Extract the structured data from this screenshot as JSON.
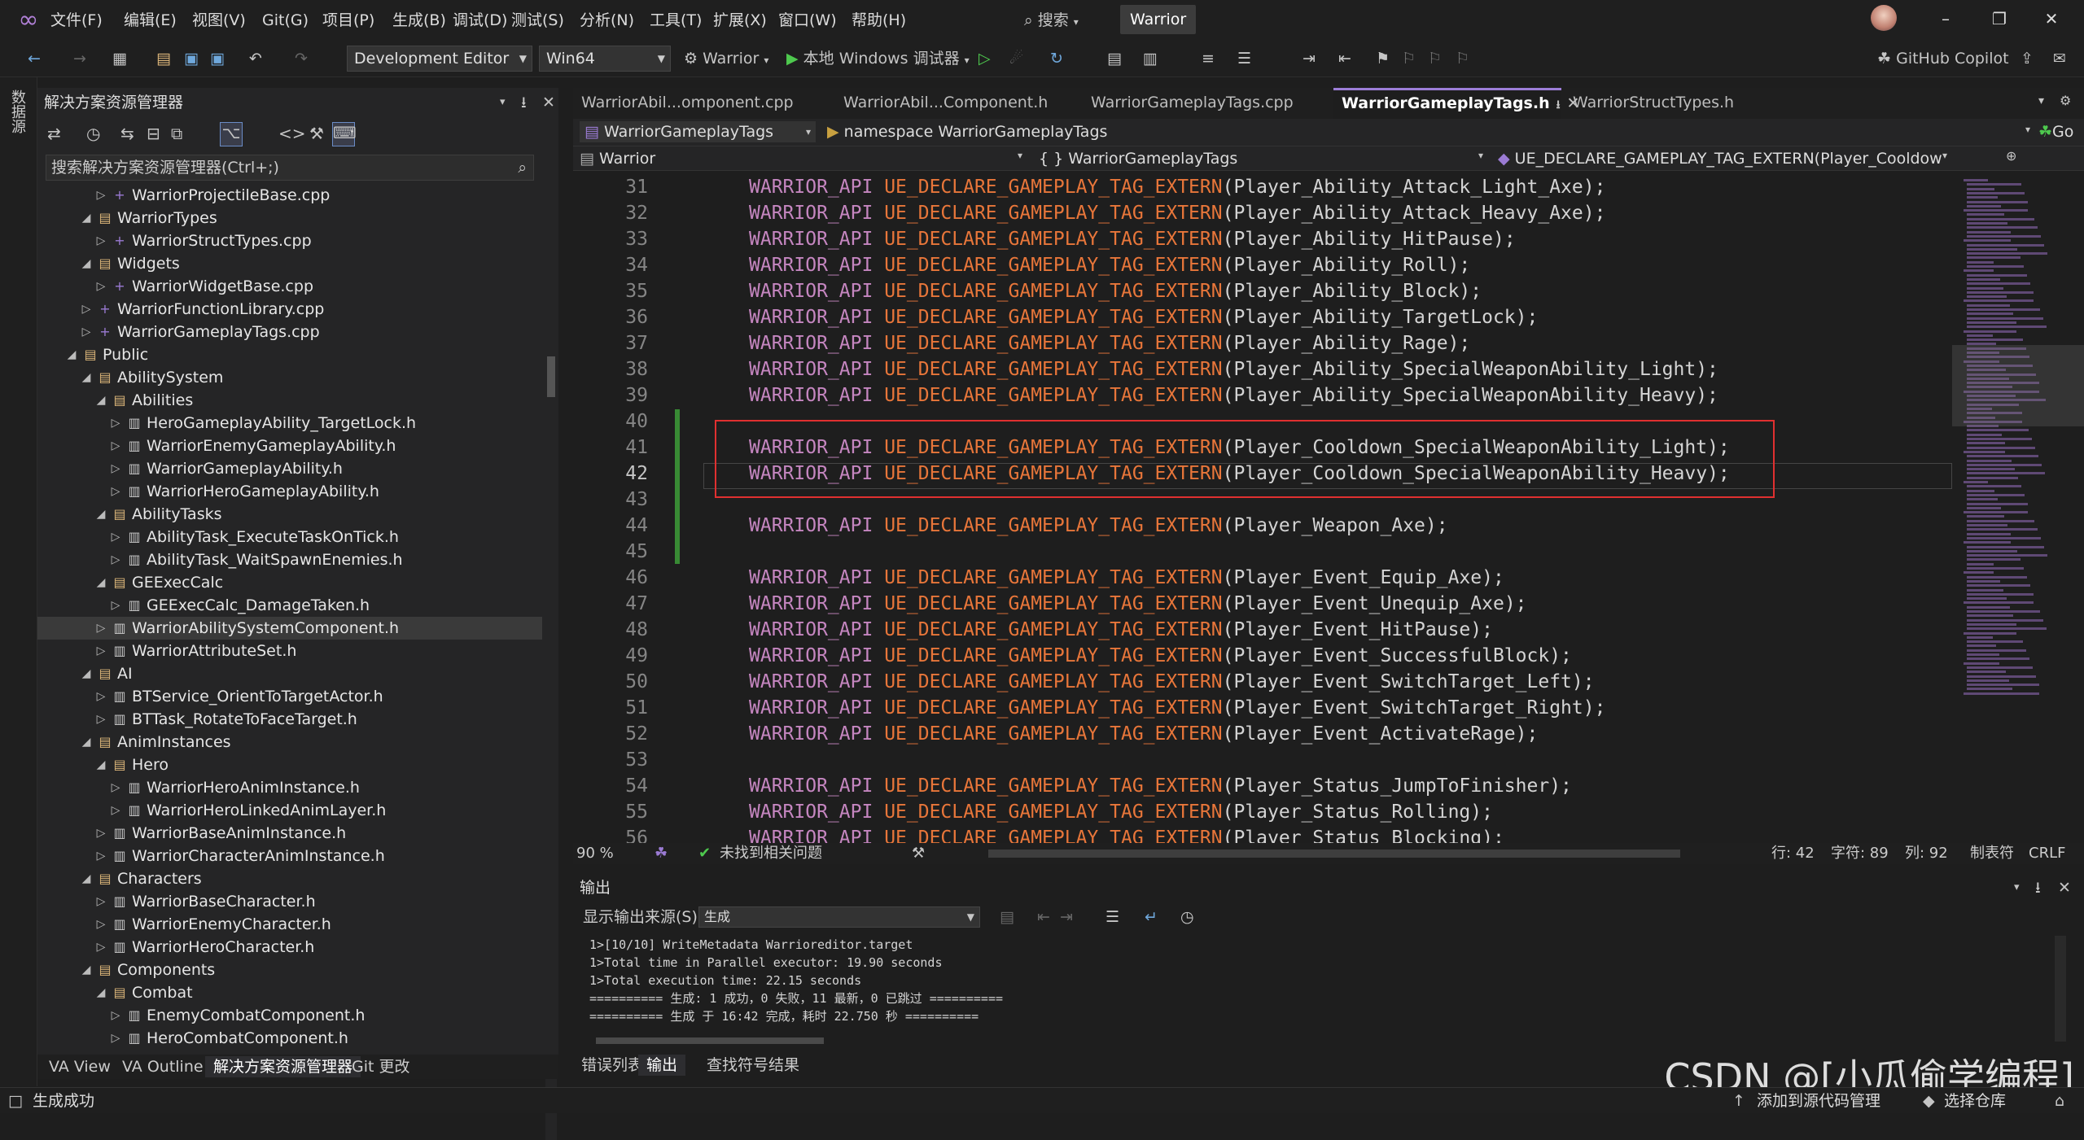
{
  "title_bar": {
    "menus": [
      "文件(F)",
      "编辑(E)",
      "视图(V)",
      "Git(G)",
      "项目(P)",
      "生成(B)",
      "调试(D)",
      "测试(S)",
      "分析(N)",
      "工具(T)",
      "扩展(X)",
      "窗口(W)",
      "帮助(H)"
    ],
    "search_label": "搜索",
    "solution_name": "Warrior"
  },
  "toolbar": {
    "config": "Development Editor",
    "platform": "Win64",
    "startup_project": "Warrior",
    "run_label": "本地 Windows 调试器",
    "copilot": "GitHub Copilot"
  },
  "left_rail": {
    "label": "数据源"
  },
  "solution_explorer": {
    "title": "解决方案资源管理器",
    "search_placeholder": "搜索解决方案资源管理器(Ctrl+;)",
    "items": [
      {
        "label": "WarriorProjectileBase.cpp",
        "kind": "cpp",
        "depth": 3,
        "expand": "closed"
      },
      {
        "label": "WarriorTypes",
        "kind": "folder",
        "depth": 2,
        "expand": "open"
      },
      {
        "label": "WarriorStructTypes.cpp",
        "kind": "cpp",
        "depth": 3,
        "expand": "closed"
      },
      {
        "label": "Widgets",
        "kind": "folder",
        "depth": 2,
        "expand": "open"
      },
      {
        "label": "WarriorWidgetBase.cpp",
        "kind": "cpp",
        "depth": 3,
        "expand": "closed"
      },
      {
        "label": "WarriorFunctionLibrary.cpp",
        "kind": "cpp",
        "depth": 2,
        "expand": "closed"
      },
      {
        "label": "WarriorGameplayTags.cpp",
        "kind": "cpp",
        "depth": 2,
        "expand": "closed"
      },
      {
        "label": "Public",
        "kind": "folder",
        "depth": 1,
        "expand": "open"
      },
      {
        "label": "AbilitySystem",
        "kind": "folder",
        "depth": 2,
        "expand": "open"
      },
      {
        "label": "Abilities",
        "kind": "folder",
        "depth": 3,
        "expand": "open"
      },
      {
        "label": "HeroGameplayAbility_TargetLock.h",
        "kind": "h",
        "depth": 4,
        "expand": "closed"
      },
      {
        "label": "WarriorEnemyGameplayAbility.h",
        "kind": "h",
        "depth": 4,
        "expand": "closed"
      },
      {
        "label": "WarriorGameplayAbility.h",
        "kind": "h",
        "depth": 4,
        "expand": "closed"
      },
      {
        "label": "WarriorHeroGameplayAbility.h",
        "kind": "h",
        "depth": 4,
        "expand": "closed"
      },
      {
        "label": "AbilityTasks",
        "kind": "folder",
        "depth": 3,
        "expand": "open"
      },
      {
        "label": "AbilityTask_ExecuteTaskOnTick.h",
        "kind": "h",
        "depth": 4,
        "expand": "closed"
      },
      {
        "label": "AbilityTask_WaitSpawnEnemies.h",
        "kind": "h",
        "depth": 4,
        "expand": "closed"
      },
      {
        "label": "GEExecCalc",
        "kind": "folder",
        "depth": 3,
        "expand": "open"
      },
      {
        "label": "GEExecCalc_DamageTaken.h",
        "kind": "h",
        "depth": 4,
        "expand": "closed"
      },
      {
        "label": "WarriorAbilitySystemComponent.h",
        "kind": "h",
        "depth": 3,
        "expand": "closed",
        "selected": true
      },
      {
        "label": "WarriorAttributeSet.h",
        "kind": "h",
        "depth": 3,
        "expand": "closed"
      },
      {
        "label": "AI",
        "kind": "folder",
        "depth": 2,
        "expand": "open"
      },
      {
        "label": "BTService_OrientToTargetActor.h",
        "kind": "h",
        "depth": 3,
        "expand": "closed"
      },
      {
        "label": "BTTask_RotateToFaceTarget.h",
        "kind": "h",
        "depth": 3,
        "expand": "closed"
      },
      {
        "label": "AnimInstances",
        "kind": "folder",
        "depth": 2,
        "expand": "open"
      },
      {
        "label": "Hero",
        "kind": "folder",
        "depth": 3,
        "expand": "open"
      },
      {
        "label": "WarriorHeroAnimInstance.h",
        "kind": "h",
        "depth": 4,
        "expand": "closed"
      },
      {
        "label": "WarriorHeroLinkedAnimLayer.h",
        "kind": "h",
        "depth": 4,
        "expand": "closed"
      },
      {
        "label": "WarriorBaseAnimInstance.h",
        "kind": "h",
        "depth": 3,
        "expand": "closed"
      },
      {
        "label": "WarriorCharacterAnimInstance.h",
        "kind": "h",
        "depth": 3,
        "expand": "closed"
      },
      {
        "label": "Characters",
        "kind": "folder",
        "depth": 2,
        "expand": "open"
      },
      {
        "label": "WarriorBaseCharacter.h",
        "kind": "h",
        "depth": 3,
        "expand": "closed"
      },
      {
        "label": "WarriorEnemyCharacter.h",
        "kind": "h",
        "depth": 3,
        "expand": "closed"
      },
      {
        "label": "WarriorHeroCharacter.h",
        "kind": "h",
        "depth": 3,
        "expand": "closed"
      },
      {
        "label": "Components",
        "kind": "folder",
        "depth": 2,
        "expand": "open"
      },
      {
        "label": "Combat",
        "kind": "folder",
        "depth": 3,
        "expand": "open"
      },
      {
        "label": "EnemyCombatComponent.h",
        "kind": "h",
        "depth": 4,
        "expand": "closed"
      },
      {
        "label": "HeroCombatComponent.h",
        "kind": "h",
        "depth": 4,
        "expand": "closed"
      }
    ],
    "bottom_tabs": [
      "VA View",
      "VA Outline",
      "解决方案资源管理器",
      "Git 更改"
    ]
  },
  "editor": {
    "tabs": [
      {
        "label": "WarriorAbil...omponent.cpp",
        "active": false
      },
      {
        "label": "WarriorAbil...Component.h",
        "active": false
      },
      {
        "label": "WarriorGameplayTags.cpp",
        "active": false
      },
      {
        "label": "WarriorGameplayTags.h",
        "active": true
      },
      {
        "label": "WarriorStructTypes.h",
        "active": false
      }
    ],
    "nav_file": "WarriorGameplayTags",
    "nav_namespace": "namespace WarriorGameplayTags",
    "nav_go": "Go",
    "nav_project": "Warrior",
    "nav_scope": "{ } WarriorGameplayTags",
    "nav_member": "UE_DECLARE_GAMEPLAY_TAG_EXTERN(Player_Cooldown_S",
    "lines": [
      {
        "n": "31",
        "arg": "Player_Ability_Attack_Light_Axe"
      },
      {
        "n": "32",
        "arg": "Player_Ability_Attack_Heavy_Axe"
      },
      {
        "n": "33",
        "arg": "Player_Ability_HitPause"
      },
      {
        "n": "34",
        "arg": "Player_Ability_Roll"
      },
      {
        "n": "35",
        "arg": "Player_Ability_Block"
      },
      {
        "n": "36",
        "arg": "Player_Ability_TargetLock"
      },
      {
        "n": "37",
        "arg": "Player_Ability_Rage"
      },
      {
        "n": "38",
        "arg": "Player_Ability_SpecialWeaponAbility_Light"
      },
      {
        "n": "39",
        "arg": "Player_Ability_SpecialWeaponAbility_Heavy"
      },
      {
        "n": "40",
        "arg": ""
      },
      {
        "n": "41",
        "arg": "Player_Cooldown_SpecialWeaponAbility_Light"
      },
      {
        "n": "42",
        "arg": "Player_Cooldown_SpecialWeaponAbility_Heavy"
      },
      {
        "n": "43",
        "arg": ""
      },
      {
        "n": "44",
        "arg": "Player_Weapon_Axe"
      },
      {
        "n": "45",
        "arg": ""
      },
      {
        "n": "46",
        "arg": "Player_Event_Equip_Axe"
      },
      {
        "n": "47",
        "arg": "Player_Event_Unequip_Axe"
      },
      {
        "n": "48",
        "arg": "Player_Event_HitPause"
      },
      {
        "n": "49",
        "arg": "Player_Event_SuccessfulBlock"
      },
      {
        "n": "50",
        "arg": "Player_Event_SwitchTarget_Left"
      },
      {
        "n": "51",
        "arg": "Player_Event_SwitchTarget_Right"
      },
      {
        "n": "52",
        "arg": "Player_Event_ActivateRage"
      },
      {
        "n": "53",
        "arg": ""
      },
      {
        "n": "54",
        "arg": "Player_Status_JumpToFinisher"
      },
      {
        "n": "55",
        "arg": "Player_Status_Rolling"
      },
      {
        "n": "56",
        "arg": "Player_Status_Blocking"
      }
    ],
    "kw_api": "WARRIOR_API",
    "kw_macro": "UE_DECLARE_GAMEPLAY_TAG_EXTERN",
    "current_line": "42",
    "status": {
      "zoom": "90 %",
      "issues": "未找到相关问题",
      "row": "行: 42",
      "char": "字符: 89",
      "col": "列: 92",
      "tabs": "制表符",
      "eol": "CRLF"
    }
  },
  "output": {
    "title": "输出",
    "source_label": "显示输出来源(S):",
    "source_value": "生成",
    "lines": [
      "1>[10/10] WriteMetadata Warrioreditor.target",
      "1>Total time in Parallel executor: 19.90 seconds",
      "1>Total execution time: 22.15 seconds",
      "========== 生成: 1 成功，0 失败，11 最新，0 已跳过 ==========",
      "========== 生成 于 16:42 完成，耗时 22.750 秒 =========="
    ],
    "tabs": [
      "错误列表",
      "输出",
      "查找符号结果"
    ]
  },
  "status_bar": {
    "message": "生成成功",
    "add_source": "添加到源代码管理",
    "select_repo": "选择仓库"
  },
  "watermark": "CSDN @[小瓜偷学编程]",
  "colors": {
    "accent": "#9d7ed8",
    "keyword": "#c586c0",
    "macro": "#e8763a",
    "change_bar": "#388a34",
    "highlight_box": "#e03030"
  }
}
